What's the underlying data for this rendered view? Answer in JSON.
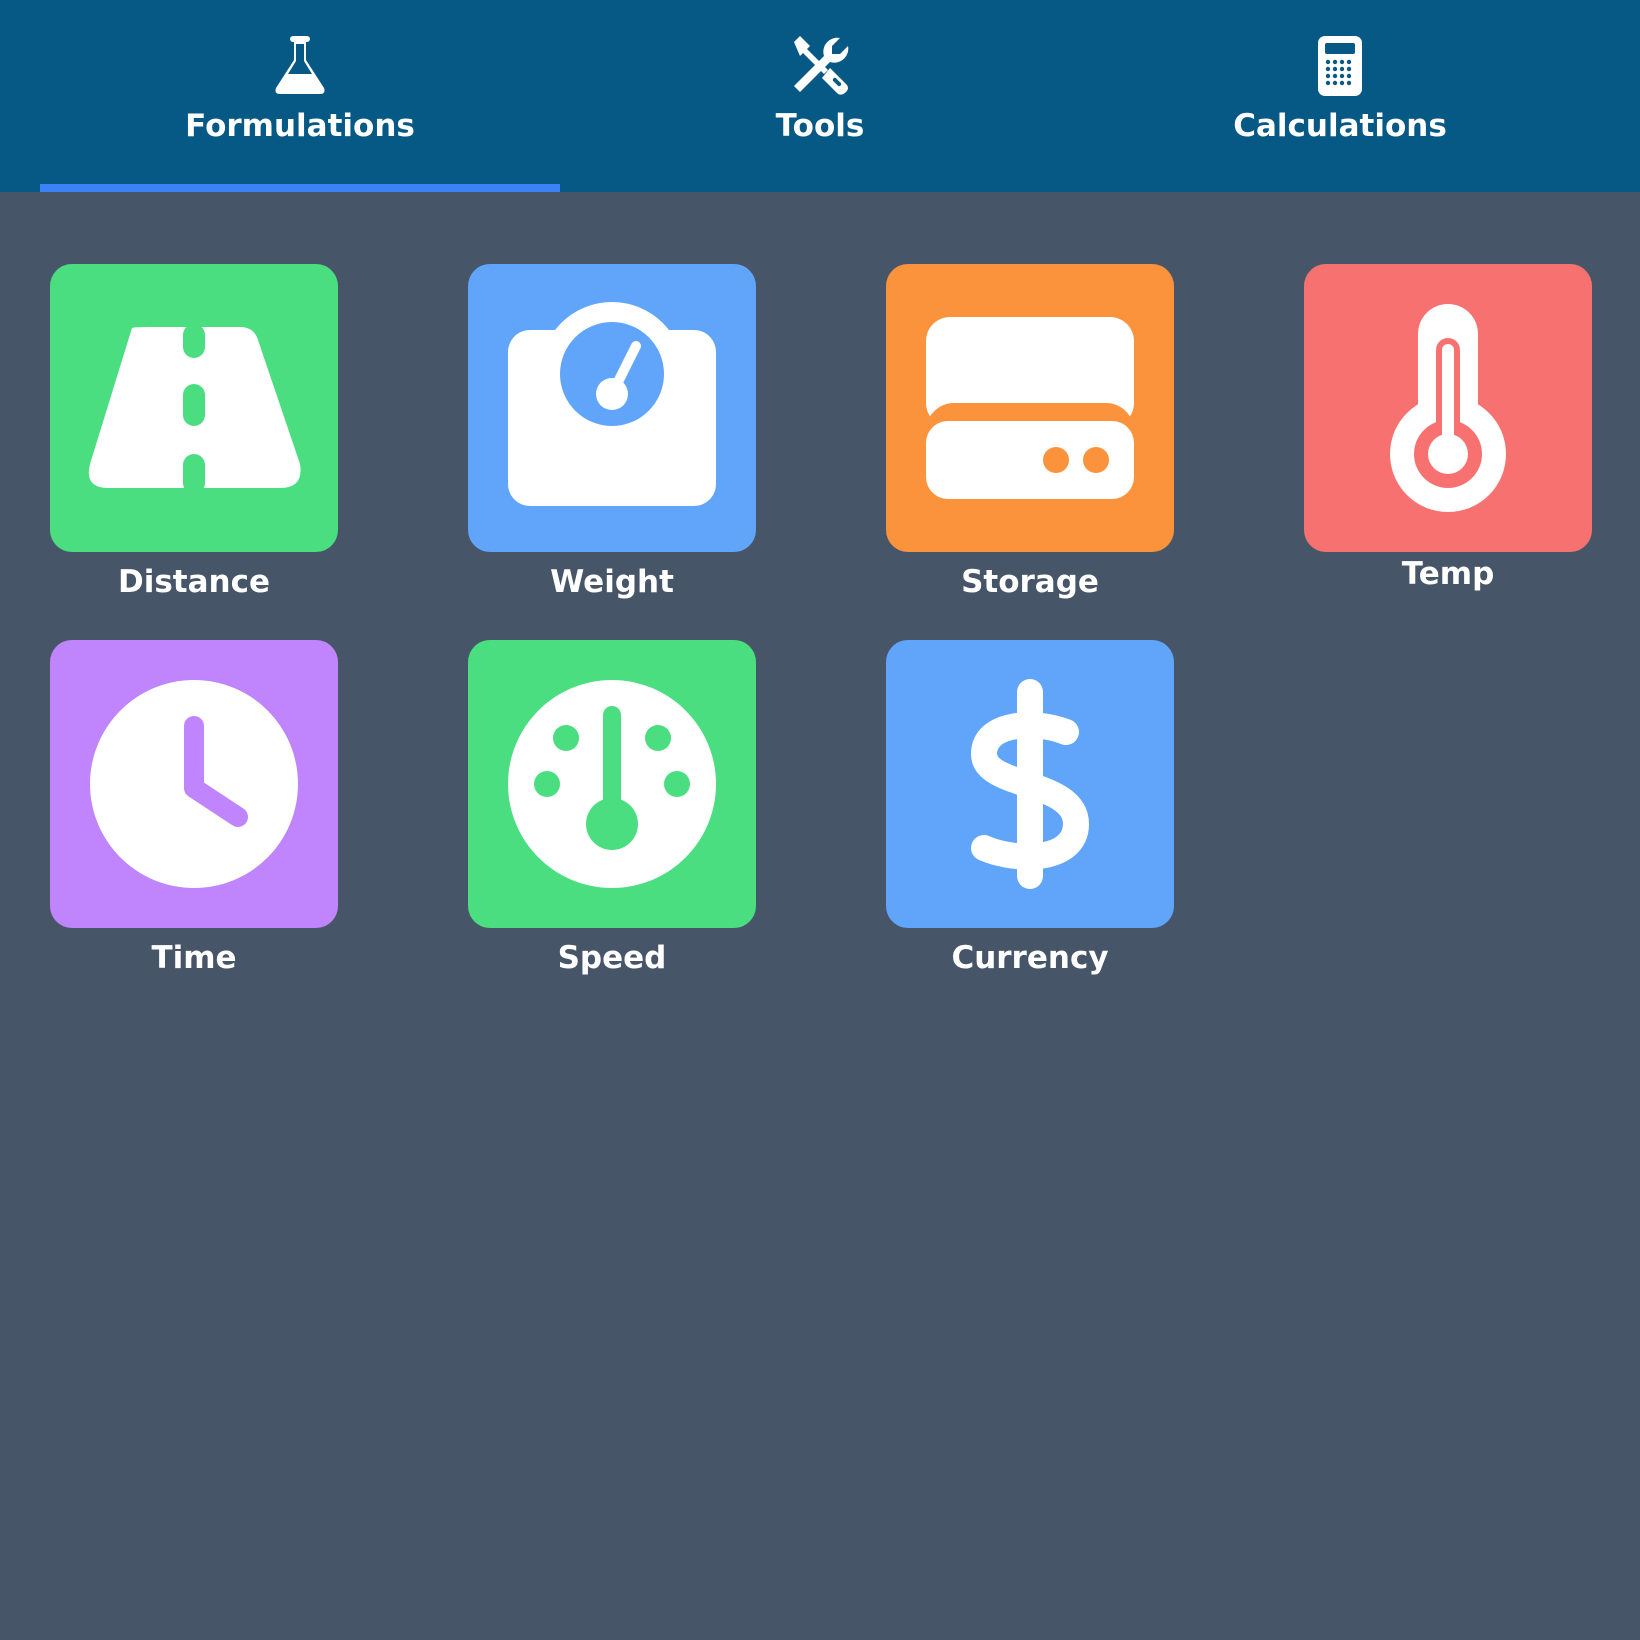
{
  "tabs": [
    {
      "label": "Formulations",
      "icon": "flask-icon",
      "active": true
    },
    {
      "label": "Tools",
      "icon": "wrench-screwdriver-icon",
      "active": false
    },
    {
      "label": "Calculations",
      "icon": "calculator-icon",
      "active": false
    }
  ],
  "colors": {
    "topbar": "#075985",
    "background": "#475569",
    "active_underline": "#3b82f6",
    "green": "#4ade80",
    "blue": "#60a5fa",
    "orange": "#fb923c",
    "red": "#f87171",
    "purple": "#c084fc"
  },
  "tiles": [
    {
      "label": "Distance",
      "icon": "road-icon",
      "color": "#4ade80"
    },
    {
      "label": "Weight",
      "icon": "scale-icon",
      "color": "#60a5fa"
    },
    {
      "label": "Storage",
      "icon": "hard-drive-icon",
      "color": "#fb923c"
    },
    {
      "label": "Temp",
      "icon": "thermometer-icon",
      "color": "#f87171"
    },
    {
      "label": "Time",
      "icon": "clock-icon",
      "color": "#c084fc"
    },
    {
      "label": "Speed",
      "icon": "speedometer-icon",
      "color": "#4ade80"
    },
    {
      "label": "Currency",
      "icon": "dollar-icon",
      "color": "#60a5fa"
    }
  ]
}
